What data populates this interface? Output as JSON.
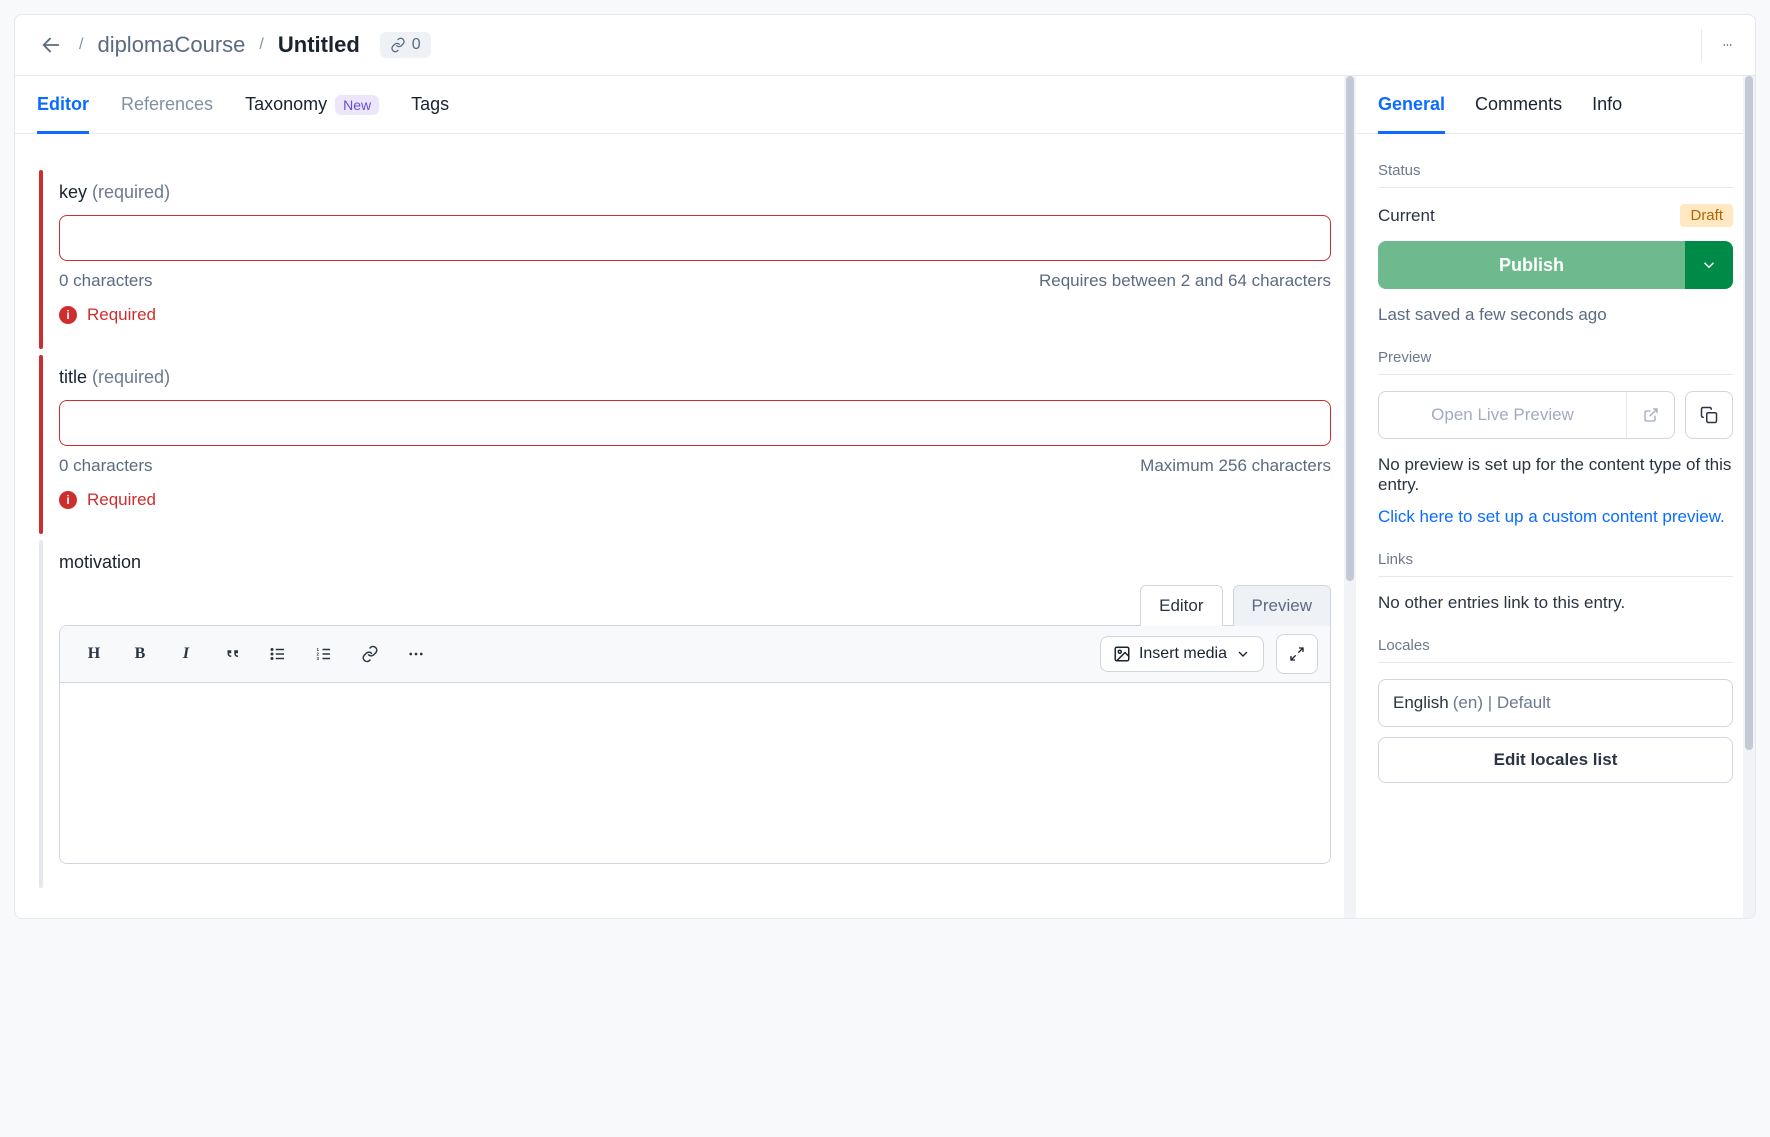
{
  "breadcrumb": {
    "parent": "diplomaCourse",
    "current": "Untitled",
    "link_count": "0"
  },
  "tabs": {
    "editor": "Editor",
    "references": "References",
    "taxonomy": "Taxonomy",
    "taxonomy_badge": "New",
    "tags": "Tags"
  },
  "fields": {
    "key": {
      "label": "key",
      "req": "(required)",
      "counter": "0 characters",
      "hint": "Requires between 2 and 64 characters",
      "error": "Required"
    },
    "title": {
      "label": "title",
      "req": "(required)",
      "counter": "0 characters",
      "hint": "Maximum 256 characters",
      "error": "Required"
    },
    "motivation": {
      "label": "motivation",
      "tab_editor": "Editor",
      "tab_preview": "Preview",
      "insert_media": "Insert media"
    }
  },
  "sidebar": {
    "tabs": {
      "general": "General",
      "comments": "Comments",
      "info": "Info"
    },
    "status": {
      "heading": "Status",
      "current_label": "Current",
      "badge": "Draft",
      "publish": "Publish",
      "saved": "Last saved a few seconds ago"
    },
    "preview": {
      "heading": "Preview",
      "open": "Open Live Preview",
      "note": "No preview is set up for the content type of this entry.",
      "link": "Click here to set up a custom content preview."
    },
    "links": {
      "heading": "Links",
      "note": "No other entries link to this entry."
    },
    "locales": {
      "heading": "Locales",
      "lang": "English",
      "suffix": "(en) | Default",
      "edit": "Edit locales list"
    }
  }
}
